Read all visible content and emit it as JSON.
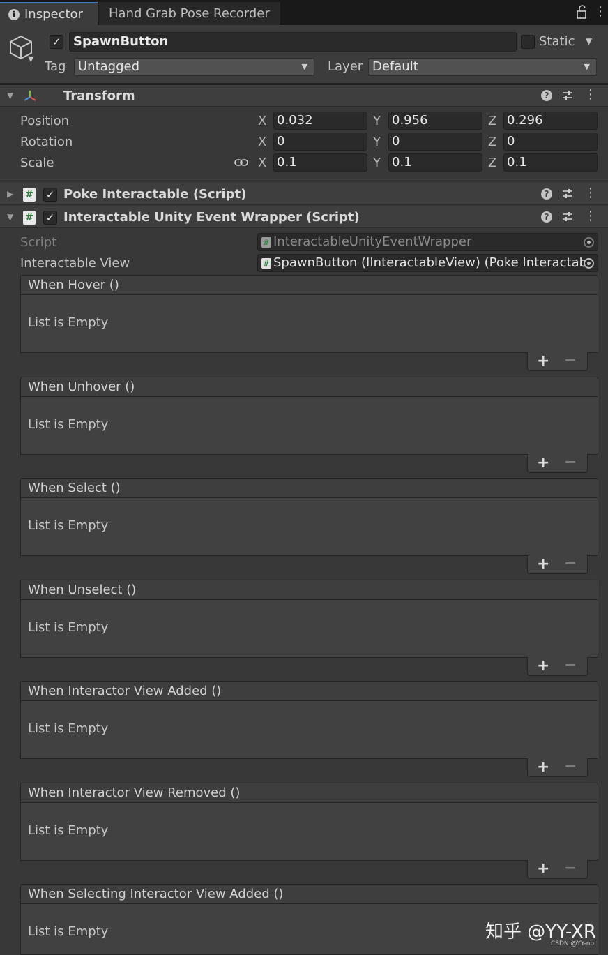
{
  "tabs": [
    {
      "label": "Inspector",
      "active": true
    },
    {
      "label": "Hand Grab Pose Recorder",
      "active": false
    }
  ],
  "gameobject": {
    "name": "SpawnButton",
    "active": true,
    "static_label": "Static",
    "tag_label": "Tag",
    "tag_value": "Untagged",
    "layer_label": "Layer",
    "layer_value": "Default"
  },
  "transform": {
    "title": "Transform",
    "position": {
      "label": "Position",
      "x": "0.032",
      "y": "0.956",
      "z": "0.296"
    },
    "rotation": {
      "label": "Rotation",
      "x": "0",
      "y": "0",
      "z": "0"
    },
    "scale": {
      "label": "Scale",
      "x": "0.1",
      "y": "0.1",
      "z": "0.1"
    },
    "axis": {
      "x": "X",
      "y": "Y",
      "z": "Z"
    }
  },
  "components": [
    {
      "title": "Poke Interactable (Script)",
      "expanded": false,
      "enabled": true
    },
    {
      "title": "Interactable Unity Event Wrapper (Script)",
      "expanded": true,
      "enabled": true
    }
  ],
  "wrapper": {
    "script_label": "Script",
    "script_value": "InteractableUnityEventWrapper",
    "view_label": "Interactable View",
    "view_value": "SpawnButton (IInteractableView) (Poke Interactab"
  },
  "events": [
    {
      "title": "When Hover ()",
      "body": "List is Empty"
    },
    {
      "title": "When Unhover ()",
      "body": "List is Empty"
    },
    {
      "title": "When Select ()",
      "body": "List is Empty"
    },
    {
      "title": "When Unselect ()",
      "body": "List is Empty"
    },
    {
      "title": "When Interactor View Added ()",
      "body": "List is Empty"
    },
    {
      "title": "When Interactor View Removed ()",
      "body": "List is Empty"
    },
    {
      "title": "When Selecting Interactor View Added ()",
      "body": "List is Empty"
    }
  ],
  "list_buttons": {
    "add": "+",
    "remove": "−"
  },
  "watermark": {
    "main": "知乎 @YY-XR",
    "small": "CSDN @YY-nb"
  },
  "icons": {
    "info": "i",
    "check": "✓",
    "help": "?",
    "menu": "⋮",
    "fold_open": "▼",
    "fold_closed": "▶",
    "dropdown": "▼",
    "script": "#"
  },
  "colors": {
    "accent": "#3a79bb",
    "script_icon": "#2b7a3c"
  }
}
